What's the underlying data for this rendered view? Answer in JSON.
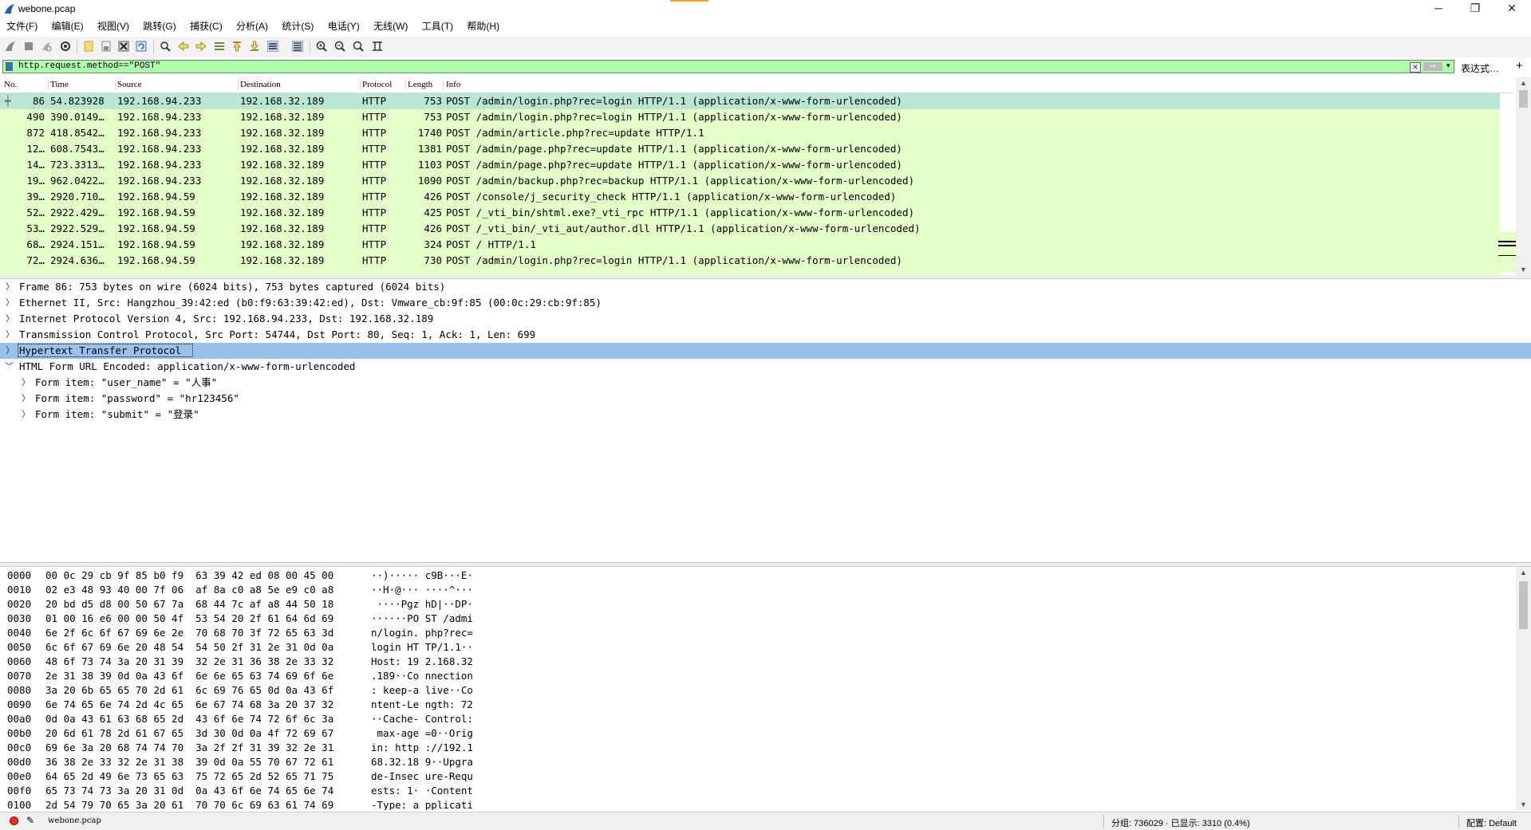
{
  "window": {
    "title": "webone.pcap",
    "minimize": "─",
    "restore": "❐",
    "close": "✕"
  },
  "menu": [
    "文件(F)",
    "编辑(E)",
    "视图(V)",
    "跳转(G)",
    "捕获(C)",
    "分析(A)",
    "统计(S)",
    "电话(Y)",
    "无线(W)",
    "工具(T)",
    "帮助(H)"
  ],
  "toolbar_icons": [
    "shark-start-icon",
    "stop-icon",
    "restart-icon",
    "options-icon",
    "open-file-icon",
    "save-file-icon",
    "close-file-icon",
    "reload-icon",
    "find-icon",
    "back-icon",
    "forward-icon",
    "go-to-packet-icon",
    "first-packet-icon",
    "last-packet-icon",
    "autoscroll-icon",
    "colorize-icon",
    "zoom-in-icon",
    "zoom-out-icon",
    "zoom-normal-icon",
    "resize-columns-icon"
  ],
  "filter": {
    "value": "http.request.method==\"POST\"",
    "expression_label": "表达式…",
    "plus": "+",
    "clear": "✕",
    "apply": "⇨",
    "dropdown": "▾",
    "bg_color": "#afffaf"
  },
  "packet_list": {
    "columns": [
      "No.",
      "Time",
      "Source",
      "Destination",
      "Protocol",
      "Length",
      "Info"
    ],
    "row_color": "#e4ffc7",
    "selected_color": "#bae6d4",
    "rows": [
      {
        "no": "86",
        "time": "54.823928",
        "src": "192.168.94.233",
        "dst": "192.168.32.189",
        "proto": "HTTP",
        "len": "753",
        "info": "POST /admin/login.php?rec=login HTTP/1.1  (application/x-www-form-urlencoded)"
      },
      {
        "no": "490",
        "time": "390.0149…",
        "src": "192.168.94.233",
        "dst": "192.168.32.189",
        "proto": "HTTP",
        "len": "753",
        "info": "POST /admin/login.php?rec=login HTTP/1.1  (application/x-www-form-urlencoded)"
      },
      {
        "no": "872",
        "time": "418.8542…",
        "src": "192.168.94.233",
        "dst": "192.168.32.189",
        "proto": "HTTP",
        "len": "1740",
        "info": "POST /admin/article.php?rec=update HTTP/1.1"
      },
      {
        "no": "12…",
        "time": "608.7543…",
        "src": "192.168.94.233",
        "dst": "192.168.32.189",
        "proto": "HTTP",
        "len": "1381",
        "info": "POST /admin/page.php?rec=update HTTP/1.1  (application/x-www-form-urlencoded)"
      },
      {
        "no": "14…",
        "time": "723.3313…",
        "src": "192.168.94.233",
        "dst": "192.168.32.189",
        "proto": "HTTP",
        "len": "1103",
        "info": "POST /admin/page.php?rec=update HTTP/1.1  (application/x-www-form-urlencoded)"
      },
      {
        "no": "19…",
        "time": "962.0422…",
        "src": "192.168.94.233",
        "dst": "192.168.32.189",
        "proto": "HTTP",
        "len": "1090",
        "info": "POST /admin/backup.php?rec=backup HTTP/1.1  (application/x-www-form-urlencoded)"
      },
      {
        "no": "39…",
        "time": "2920.710…",
        "src": "192.168.94.59",
        "dst": "192.168.32.189",
        "proto": "HTTP",
        "len": "426",
        "info": "POST /console/j_security_check HTTP/1.1  (application/x-www-form-urlencoded)"
      },
      {
        "no": "52…",
        "time": "2922.429…",
        "src": "192.168.94.59",
        "dst": "192.168.32.189",
        "proto": "HTTP",
        "len": "425",
        "info": "POST /_vti_bin/shtml.exe?_vti_rpc HTTP/1.1  (application/x-www-form-urlencoded)"
      },
      {
        "no": "53…",
        "time": "2922.529…",
        "src": "192.168.94.59",
        "dst": "192.168.32.189",
        "proto": "HTTP",
        "len": "426",
        "info": "POST /_vti_bin/_vti_aut/author.dll HTTP/1.1  (application/x-www-form-urlencoded)"
      },
      {
        "no": "68…",
        "time": "2924.151…",
        "src": "192.168.94.59",
        "dst": "192.168.32.189",
        "proto": "HTTP",
        "len": "324",
        "info": "POST / HTTP/1.1"
      },
      {
        "no": "72…",
        "time": "2924.636…",
        "src": "192.168.94.59",
        "dst": "192.168.32.189",
        "proto": "HTTP",
        "len": "730",
        "info": "POST /admin/login.php?rec=login HTTP/1.1  (application/x-www-form-urlencoded)"
      }
    ]
  },
  "details": [
    {
      "indent": 0,
      "expanded": false,
      "text": "Frame 86: 753 bytes on wire (6024 bits), 753 bytes captured (6024 bits)"
    },
    {
      "indent": 0,
      "expanded": false,
      "text": "Ethernet II, Src: Hangzhou_39:42:ed (b0:f9:63:39:42:ed), Dst: Vmware_cb:9f:85 (00:0c:29:cb:9f:85)"
    },
    {
      "indent": 0,
      "expanded": false,
      "text": "Internet Protocol Version 4, Src: 192.168.94.233, Dst: 192.168.32.189"
    },
    {
      "indent": 0,
      "expanded": false,
      "text": "Transmission Control Protocol, Src Port: 54744, Dst Port: 80, Seq: 1, Ack: 1, Len: 699"
    },
    {
      "indent": 0,
      "expanded": false,
      "highlight": true,
      "text": "Hypertext Transfer Protocol"
    },
    {
      "indent": 0,
      "expanded": true,
      "text": "HTML Form URL Encoded: application/x-www-form-urlencoded"
    },
    {
      "indent": 1,
      "expanded": false,
      "text": "Form item: \"user_name\" = \"人事\""
    },
    {
      "indent": 1,
      "expanded": false,
      "text": "Form item: \"password\" = \"hr123456\""
    },
    {
      "indent": 1,
      "expanded": false,
      "text": "Form item: \"submit\" = \"登录\""
    }
  ],
  "bytes": [
    {
      "off": "0000",
      "hex": "00 0c 29 cb 9f 85 b0 f9  63 39 42 ed 08 00 45 00",
      "ascii": "··)····· c9B···E·"
    },
    {
      "off": "0010",
      "hex": "02 e3 48 93 40 00 7f 06  af 8a c0 a8 5e e9 c0 a8",
      "ascii": "··H·@··· ····^···"
    },
    {
      "off": "0020",
      "hex": "20 bd d5 d8 00 50 67 7a  68 44 7c af a8 44 50 18",
      "ascii": " ····Pgz hD|··DP·"
    },
    {
      "off": "0030",
      "hex": "01 00 16 e6 00 00 50 4f  53 54 20 2f 61 64 6d 69",
      "ascii": "······PO ST /admi"
    },
    {
      "off": "0040",
      "hex": "6e 2f 6c 6f 67 69 6e 2e  70 68 70 3f 72 65 63 3d",
      "ascii": "n/login. php?rec="
    },
    {
      "off": "0050",
      "hex": "6c 6f 67 69 6e 20 48 54  54 50 2f 31 2e 31 0d 0a",
      "ascii": "login HT TP/1.1··"
    },
    {
      "off": "0060",
      "hex": "48 6f 73 74 3a 20 31 39  32 2e 31 36 38 2e 33 32",
      "ascii": "Host: 19 2.168.32"
    },
    {
      "off": "0070",
      "hex": "2e 31 38 39 0d 0a 43 6f  6e 6e 65 63 74 69 6f 6e",
      "ascii": ".189··Co nnection"
    },
    {
      "off": "0080",
      "hex": "3a 20 6b 65 65 70 2d 61  6c 69 76 65 0d 0a 43 6f",
      "ascii": ": keep-a live··Co"
    },
    {
      "off": "0090",
      "hex": "6e 74 65 6e 74 2d 4c 65  6e 67 74 68 3a 20 37 32",
      "ascii": "ntent-Le ngth: 72"
    },
    {
      "off": "00a0",
      "hex": "0d 0a 43 61 63 68 65 2d  43 6f 6e 74 72 6f 6c 3a",
      "ascii": "··Cache- Control:"
    },
    {
      "off": "00b0",
      "hex": "20 6d 61 78 2d 61 67 65  3d 30 0d 0a 4f 72 69 67",
      "ascii": " max-age =0··Orig"
    },
    {
      "off": "00c0",
      "hex": "69 6e 3a 20 68 74 74 70  3a 2f 2f 31 39 32 2e 31",
      "ascii": "in: http ://192.1"
    },
    {
      "off": "00d0",
      "hex": "36 38 2e 33 32 2e 31 38  39 0d 0a 55 70 67 72 61",
      "ascii": "68.32.18 9··Upgra"
    },
    {
      "off": "00e0",
      "hex": "64 65 2d 49 6e 73 65 63  75 72 65 2d 52 65 71 75",
      "ascii": "de-Insec ure-Requ"
    },
    {
      "off": "00f0",
      "hex": "65 73 74 73 3a 20 31 0d  0a 43 6f 6e 74 65 6e 74",
      "ascii": "ests: 1· ·Content"
    },
    {
      "off": "0100",
      "hex": "2d 54 79 70 65 3a 20 61  70 70 6c 69 63 61 74 69",
      "ascii": "-Type: a pplicati"
    }
  ],
  "status": {
    "file": "webone.pcap",
    "packets": "分组: 736029 · 已显示: 3310 (0.4%)",
    "profile": "配置: Default"
  }
}
